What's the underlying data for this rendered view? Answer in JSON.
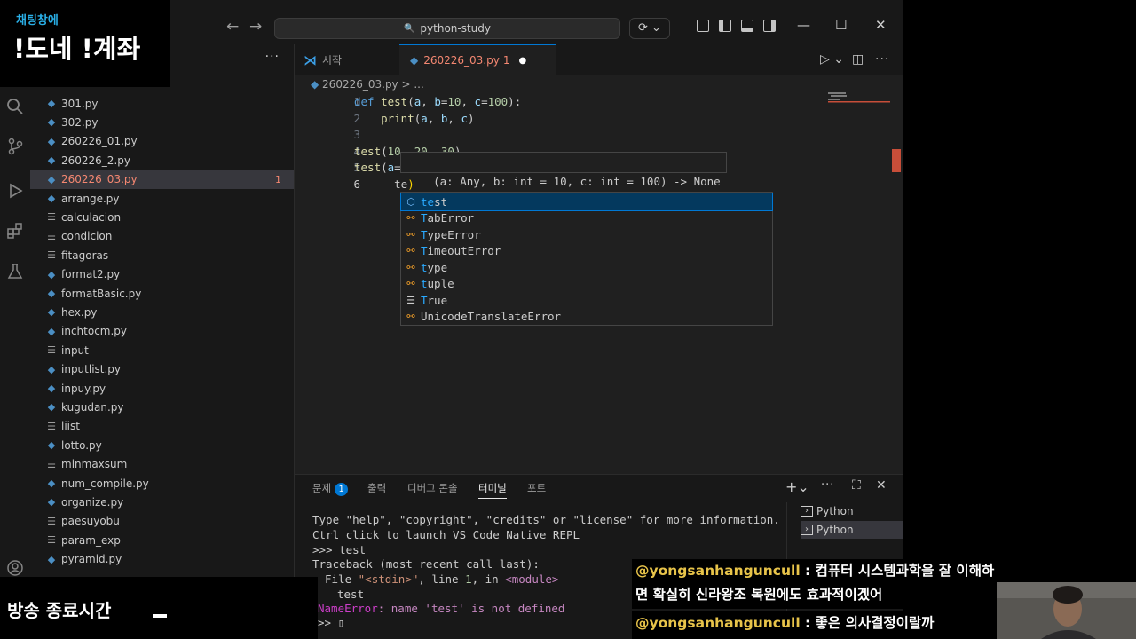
{
  "overlay": {
    "chat_label": "채팅창에",
    "chat_big": "!도네 !계좌",
    "end_label": "방송 종료시간"
  },
  "titlebar": {
    "search": "python-study",
    "back": "←",
    "forward": "→",
    "search_icon": "🔍",
    "copilot": "⟳ ⌄",
    "minimize": "—",
    "maximize": "☐",
    "close": "✕"
  },
  "sidebar": {
    "more": "···",
    "files": [
      {
        "name": "301.py",
        "type": "py"
      },
      {
        "name": "302.py",
        "type": "py"
      },
      {
        "name": "260226_01.py",
        "type": "py"
      },
      {
        "name": "260226_2.py",
        "type": "py"
      },
      {
        "name": "260226_03.py",
        "type": "py",
        "selected": true,
        "badge": "1"
      },
      {
        "name": "arrange.py",
        "type": "py"
      },
      {
        "name": "calculacion",
        "type": "txt"
      },
      {
        "name": "condicion",
        "type": "txt"
      },
      {
        "name": "fitagoras",
        "type": "txt"
      },
      {
        "name": "format2.py",
        "type": "py"
      },
      {
        "name": "formatBasic.py",
        "type": "py"
      },
      {
        "name": "hex.py",
        "type": "py"
      },
      {
        "name": "inchtocm.py",
        "type": "py"
      },
      {
        "name": "input",
        "type": "txt"
      },
      {
        "name": "inputlist.py",
        "type": "py"
      },
      {
        "name": "inpuy.py",
        "type": "py"
      },
      {
        "name": "kugudan.py",
        "type": "py"
      },
      {
        "name": "liist",
        "type": "txt"
      },
      {
        "name": "lotto.py",
        "type": "py"
      },
      {
        "name": "minmaxsum",
        "type": "txt"
      },
      {
        "name": "num_compile.py",
        "type": "py"
      },
      {
        "name": "organize.py",
        "type": "py"
      },
      {
        "name": "paesuyobu",
        "type": "txt"
      },
      {
        "name": "param_exp",
        "type": "txt"
      },
      {
        "name": "pyramid.py",
        "type": "py"
      }
    ]
  },
  "tabs": {
    "start": "시작",
    "active": "260226_03.py",
    "active_badge": "1",
    "dirty_dot": "●"
  },
  "breadcrumb": "260226_03.py > ...",
  "editor": {
    "line_numbers": [
      "1",
      "2",
      "3",
      "4",
      "5",
      "6"
    ],
    "hint": "(a: Any, b: int = 10, c: int = 100) -> None",
    "suggestions": [
      {
        "label": "test",
        "match": "te",
        "kind": "function",
        "selected": true
      },
      {
        "label": "TabError",
        "match": "T",
        "kind": "class"
      },
      {
        "label": "TypeError",
        "match": "T",
        "kind": "class"
      },
      {
        "label": "TimeoutError",
        "match": "T",
        "kind": "class"
      },
      {
        "label": "type",
        "match": "t",
        "kind": "class"
      },
      {
        "label": "tuple",
        "match": "t",
        "kind": "class"
      },
      {
        "label": "True",
        "match": "T",
        "kind": "keyword"
      },
      {
        "label": "UnicodeTranslateError",
        "match": "",
        "kind": "class"
      }
    ]
  },
  "panel": {
    "tabs": [
      "문제",
      "출력",
      "디버그 콘솔",
      "터미널",
      "포트"
    ],
    "problems_badge": "1",
    "terminal_lines": [
      "Type \"help\", \"copyright\", \"credits\" or \"license\" for more information.",
      "Ctrl click to launch VS Code Native REPL",
      ">>> test",
      "Traceback (most recent call last):"
    ],
    "terminals": [
      "Python",
      "Python"
    ]
  },
  "chat": [
    {
      "user": "@yongsanhanguncull",
      "text": " : 컴퓨터 시스템과학을 잘 이해하면 확실히 신라왕조 복원에도 효과적이겠어"
    },
    {
      "user": "@yongsanhanguncull",
      "text": " : 좋은 의사결정이랄까"
    }
  ]
}
